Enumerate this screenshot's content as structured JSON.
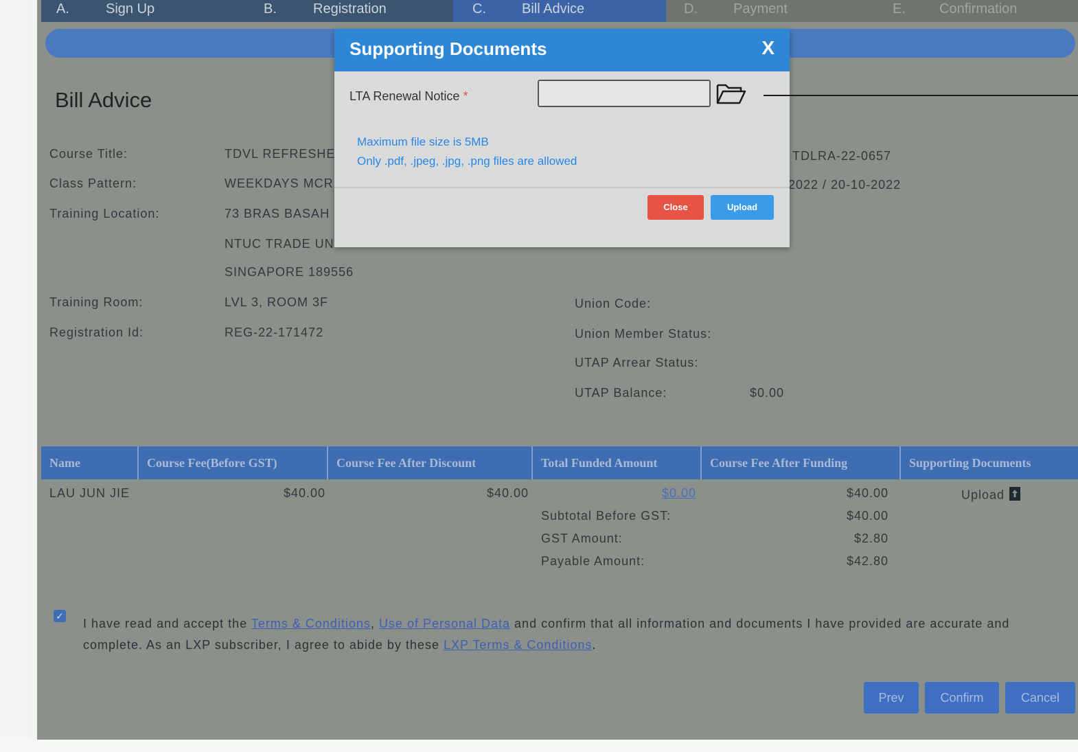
{
  "steps": [
    {
      "letter": "A.",
      "label": "Sign Up"
    },
    {
      "letter": "B.",
      "label": "Registration"
    },
    {
      "letter": "C.",
      "label": "Bill Advice"
    },
    {
      "letter": "D.",
      "label": "Payment"
    },
    {
      "letter": "E.",
      "label": "Confirmation"
    }
  ],
  "page_title": "Bill Advice",
  "fields_left": [
    {
      "label": "Course Title:",
      "value": "TDVL REFRESHE"
    },
    {
      "label": "Class Pattern:",
      "value": "WEEKDAYS MCR"
    },
    {
      "label": "Training Location:",
      "value": "73 BRAS BASAH"
    },
    {
      "label": "",
      "value": "NTUC TRADE UN"
    },
    {
      "label": "",
      "value": "SINGAPORE 189556"
    },
    {
      "label": "Training Room:",
      "value": "LVL 3, ROOM 3F"
    },
    {
      "label": "Registration Id:",
      "value": "REG-22-171472"
    }
  ],
  "fields_right_partial": [
    {
      "value": "TDLRA-22-0657"
    },
    {
      "value": "2022 / 20-10-2022"
    }
  ],
  "fields_right": [
    {
      "label": "Union Code:",
      "value": ""
    },
    {
      "label": "Union Member Status:",
      "value": ""
    },
    {
      "label": "UTAP Arrear Status:",
      "value": ""
    },
    {
      "label": "UTAP Balance:",
      "value": "$0.00"
    }
  ],
  "table": {
    "headers": [
      "Name",
      "Course Fee(Before GST)",
      "Course Fee After Discount",
      "Total Funded Amount",
      "Course Fee After Funding",
      "Supporting Documents"
    ],
    "row": {
      "name": "LAU JUN JIE",
      "fee_before_gst": "$40.00",
      "fee_after_discount": "$40.00",
      "total_funded": "$0.00",
      "fee_after_funding": "$40.00",
      "supporting_docs": "Upload"
    },
    "summary": [
      {
        "label": "Subtotal Before GST:",
        "value": "$40.00"
      },
      {
        "label": "GST Amount:",
        "value": "$2.80"
      },
      {
        "label": "Payable Amount:",
        "value": "$42.80"
      }
    ]
  },
  "terms": {
    "checked": true,
    "text_1": "I have read and accept the",
    "link_1": "Terms & Conditions",
    "sep": ",",
    "link_2": "Use of Personal Data",
    "text_2": "and confirm that all information and documents I have provided are accurate and complete. As an LXP subscriber, I agree to abide by these",
    "link_3": "LXP Terms & Conditions",
    "text_3": "."
  },
  "footer_buttons": {
    "prev": "Prev",
    "confirm": "Confirm",
    "cancel": "Cancel"
  },
  "modal": {
    "title": "Supporting Documents",
    "close_glyph": "X",
    "field_label": "LTA Renewal Notice",
    "required_mark": "*",
    "note_1": "Maximum file size is 5MB",
    "note_2": "Only .pdf, .jpeg, .jpg, .png files are allowed",
    "close_button": "Close",
    "upload_button": "Upload"
  },
  "colors": {
    "modal_header": "#2d86d6",
    "close_button": "#e85444",
    "upload_button": "#3a9be8",
    "table_header": "#3e6eb1"
  }
}
